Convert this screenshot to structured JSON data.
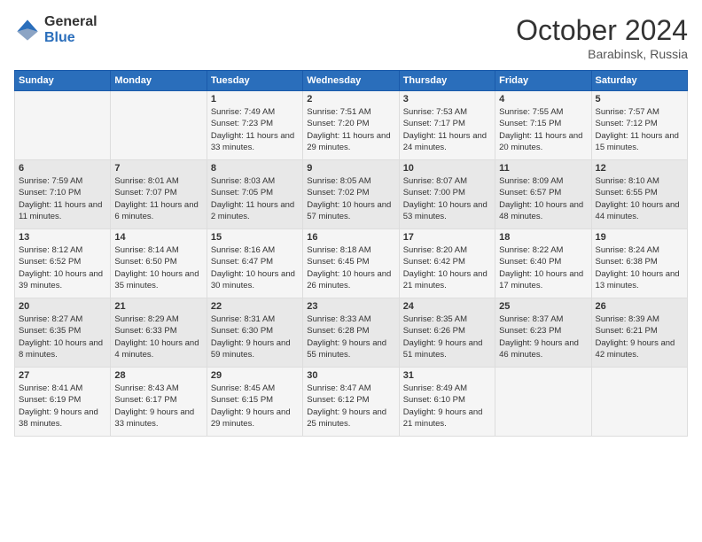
{
  "logo": {
    "general": "General",
    "blue": "Blue"
  },
  "header": {
    "month": "October 2024",
    "location": "Barabinsk, Russia"
  },
  "days_of_week": [
    "Sunday",
    "Monday",
    "Tuesday",
    "Wednesday",
    "Thursday",
    "Friday",
    "Saturday"
  ],
  "weeks": [
    [
      {
        "day": "",
        "sunrise": "",
        "sunset": "",
        "daylight": ""
      },
      {
        "day": "",
        "sunrise": "",
        "sunset": "",
        "daylight": ""
      },
      {
        "day": "1",
        "sunrise": "Sunrise: 7:49 AM",
        "sunset": "Sunset: 7:23 PM",
        "daylight": "Daylight: 11 hours and 33 minutes."
      },
      {
        "day": "2",
        "sunrise": "Sunrise: 7:51 AM",
        "sunset": "Sunset: 7:20 PM",
        "daylight": "Daylight: 11 hours and 29 minutes."
      },
      {
        "day": "3",
        "sunrise": "Sunrise: 7:53 AM",
        "sunset": "Sunset: 7:17 PM",
        "daylight": "Daylight: 11 hours and 24 minutes."
      },
      {
        "day": "4",
        "sunrise": "Sunrise: 7:55 AM",
        "sunset": "Sunset: 7:15 PM",
        "daylight": "Daylight: 11 hours and 20 minutes."
      },
      {
        "day": "5",
        "sunrise": "Sunrise: 7:57 AM",
        "sunset": "Sunset: 7:12 PM",
        "daylight": "Daylight: 11 hours and 15 minutes."
      }
    ],
    [
      {
        "day": "6",
        "sunrise": "Sunrise: 7:59 AM",
        "sunset": "Sunset: 7:10 PM",
        "daylight": "Daylight: 11 hours and 11 minutes."
      },
      {
        "day": "7",
        "sunrise": "Sunrise: 8:01 AM",
        "sunset": "Sunset: 7:07 PM",
        "daylight": "Daylight: 11 hours and 6 minutes."
      },
      {
        "day": "8",
        "sunrise": "Sunrise: 8:03 AM",
        "sunset": "Sunset: 7:05 PM",
        "daylight": "Daylight: 11 hours and 2 minutes."
      },
      {
        "day": "9",
        "sunrise": "Sunrise: 8:05 AM",
        "sunset": "Sunset: 7:02 PM",
        "daylight": "Daylight: 10 hours and 57 minutes."
      },
      {
        "day": "10",
        "sunrise": "Sunrise: 8:07 AM",
        "sunset": "Sunset: 7:00 PM",
        "daylight": "Daylight: 10 hours and 53 minutes."
      },
      {
        "day": "11",
        "sunrise": "Sunrise: 8:09 AM",
        "sunset": "Sunset: 6:57 PM",
        "daylight": "Daylight: 10 hours and 48 minutes."
      },
      {
        "day": "12",
        "sunrise": "Sunrise: 8:10 AM",
        "sunset": "Sunset: 6:55 PM",
        "daylight": "Daylight: 10 hours and 44 minutes."
      }
    ],
    [
      {
        "day": "13",
        "sunrise": "Sunrise: 8:12 AM",
        "sunset": "Sunset: 6:52 PM",
        "daylight": "Daylight: 10 hours and 39 minutes."
      },
      {
        "day": "14",
        "sunrise": "Sunrise: 8:14 AM",
        "sunset": "Sunset: 6:50 PM",
        "daylight": "Daylight: 10 hours and 35 minutes."
      },
      {
        "day": "15",
        "sunrise": "Sunrise: 8:16 AM",
        "sunset": "Sunset: 6:47 PM",
        "daylight": "Daylight: 10 hours and 30 minutes."
      },
      {
        "day": "16",
        "sunrise": "Sunrise: 8:18 AM",
        "sunset": "Sunset: 6:45 PM",
        "daylight": "Daylight: 10 hours and 26 minutes."
      },
      {
        "day": "17",
        "sunrise": "Sunrise: 8:20 AM",
        "sunset": "Sunset: 6:42 PM",
        "daylight": "Daylight: 10 hours and 21 minutes."
      },
      {
        "day": "18",
        "sunrise": "Sunrise: 8:22 AM",
        "sunset": "Sunset: 6:40 PM",
        "daylight": "Daylight: 10 hours and 17 minutes."
      },
      {
        "day": "19",
        "sunrise": "Sunrise: 8:24 AM",
        "sunset": "Sunset: 6:38 PM",
        "daylight": "Daylight: 10 hours and 13 minutes."
      }
    ],
    [
      {
        "day": "20",
        "sunrise": "Sunrise: 8:27 AM",
        "sunset": "Sunset: 6:35 PM",
        "daylight": "Daylight: 10 hours and 8 minutes."
      },
      {
        "day": "21",
        "sunrise": "Sunrise: 8:29 AM",
        "sunset": "Sunset: 6:33 PM",
        "daylight": "Daylight: 10 hours and 4 minutes."
      },
      {
        "day": "22",
        "sunrise": "Sunrise: 8:31 AM",
        "sunset": "Sunset: 6:30 PM",
        "daylight": "Daylight: 9 hours and 59 minutes."
      },
      {
        "day": "23",
        "sunrise": "Sunrise: 8:33 AM",
        "sunset": "Sunset: 6:28 PM",
        "daylight": "Daylight: 9 hours and 55 minutes."
      },
      {
        "day": "24",
        "sunrise": "Sunrise: 8:35 AM",
        "sunset": "Sunset: 6:26 PM",
        "daylight": "Daylight: 9 hours and 51 minutes."
      },
      {
        "day": "25",
        "sunrise": "Sunrise: 8:37 AM",
        "sunset": "Sunset: 6:23 PM",
        "daylight": "Daylight: 9 hours and 46 minutes."
      },
      {
        "day": "26",
        "sunrise": "Sunrise: 8:39 AM",
        "sunset": "Sunset: 6:21 PM",
        "daylight": "Daylight: 9 hours and 42 minutes."
      }
    ],
    [
      {
        "day": "27",
        "sunrise": "Sunrise: 8:41 AM",
        "sunset": "Sunset: 6:19 PM",
        "daylight": "Daylight: 9 hours and 38 minutes."
      },
      {
        "day": "28",
        "sunrise": "Sunrise: 8:43 AM",
        "sunset": "Sunset: 6:17 PM",
        "daylight": "Daylight: 9 hours and 33 minutes."
      },
      {
        "day": "29",
        "sunrise": "Sunrise: 8:45 AM",
        "sunset": "Sunset: 6:15 PM",
        "daylight": "Daylight: 9 hours and 29 minutes."
      },
      {
        "day": "30",
        "sunrise": "Sunrise: 8:47 AM",
        "sunset": "Sunset: 6:12 PM",
        "daylight": "Daylight: 9 hours and 25 minutes."
      },
      {
        "day": "31",
        "sunrise": "Sunrise: 8:49 AM",
        "sunset": "Sunset: 6:10 PM",
        "daylight": "Daylight: 9 hours and 21 minutes."
      },
      {
        "day": "",
        "sunrise": "",
        "sunset": "",
        "daylight": ""
      },
      {
        "day": "",
        "sunrise": "",
        "sunset": "",
        "daylight": ""
      }
    ]
  ]
}
